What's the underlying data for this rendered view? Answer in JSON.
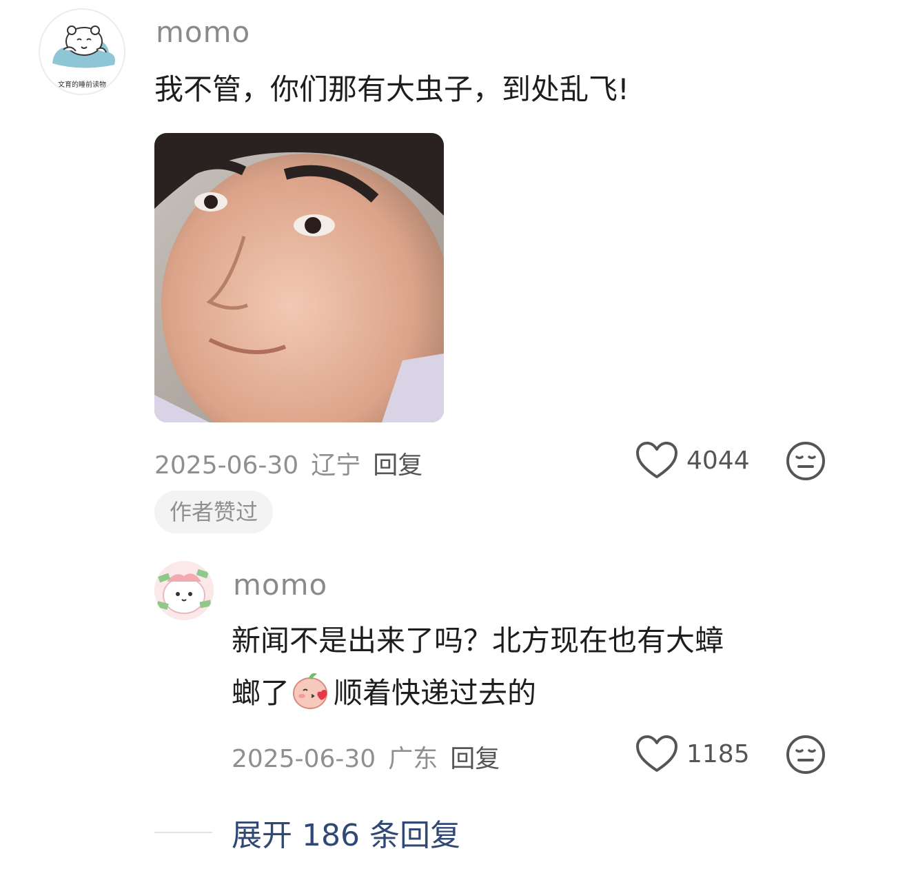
{
  "comment": {
    "username": "momo",
    "avatar_caption": "文育的睡前读物",
    "text": "我不管，你们那有大虫子，到处乱飞!",
    "date": "2025-06-30",
    "region": "辽宁",
    "reply_label": "回复",
    "like_count": "4044",
    "author_badge": "作者赞过"
  },
  "reply": {
    "username": "momo",
    "text_line1": "新闻不是出来了吗？北方现在也有大蟑",
    "text_line2_before_emoji": "螂了",
    "text_line2_after_emoji": "顺着快递过去的",
    "inline_emoji": "blushing-kiss-emoji",
    "date": "2025-06-30",
    "region": "广东",
    "reply_label": "回复",
    "like_count": "1185"
  },
  "expand": {
    "label": "展开 186 条回复"
  },
  "icons": {
    "like": "heart-outline-icon",
    "dislike": "meh-face-icon"
  },
  "colors": {
    "username": "#8a8a8a",
    "text": "#1d1d1d",
    "meta": "#8f8f8f",
    "expand_link": "#2f4876",
    "badge_bg": "#f3f3f3"
  }
}
